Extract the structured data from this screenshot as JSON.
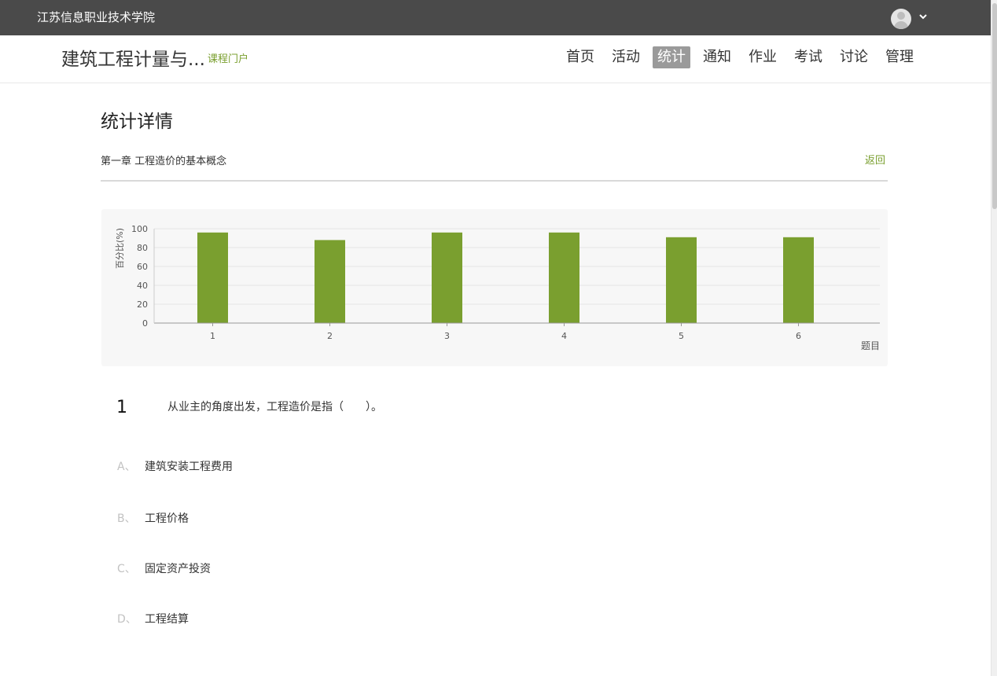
{
  "topbar": {
    "school_name": "江苏信息职业技术学院",
    "avatar_icon": "user-avatar-icon",
    "caret_icon": "chevron-down-icon"
  },
  "header": {
    "course_title": "建筑工程计量与...",
    "course_portal": "课程门户",
    "nav": [
      {
        "label": "首页"
      },
      {
        "label": "活动"
      },
      {
        "label": "统计",
        "active": true
      },
      {
        "label": "通知"
      },
      {
        "label": "作业"
      },
      {
        "label": "考试"
      },
      {
        "label": "讨论"
      },
      {
        "label": "管理"
      }
    ]
  },
  "main": {
    "page_title": "统计详情",
    "chapter_title": "第一章  工程造价的基本概念",
    "back_label": "返回"
  },
  "chart_data": {
    "type": "bar",
    "categories": [
      "1",
      "2",
      "3",
      "4",
      "5",
      "6"
    ],
    "values": [
      96,
      88,
      96,
      96,
      91,
      91
    ],
    "ylabel": "百分比(%)",
    "xlabel": "题目",
    "ylim": [
      0,
      100
    ],
    "yticks": [
      "0",
      "20",
      "40",
      "60",
      "80",
      "100"
    ],
    "grid": true,
    "bar_color": "#7a9f2f"
  },
  "question": {
    "number": "1",
    "text": "从业主的角度出发，工程造价是指（　　）。",
    "options": [
      {
        "letter": "A、",
        "text": "建筑安装工程费用"
      },
      {
        "letter": "B、",
        "text": "工程价格"
      },
      {
        "letter": "C、",
        "text": "固定资产投资"
      },
      {
        "letter": "D、",
        "text": "工程结算"
      }
    ]
  },
  "colors": {
    "topbar_bg": "#4a4a4a",
    "accent_green": "#7a9f2f",
    "nav_active_bg": "#9a9a9a"
  }
}
